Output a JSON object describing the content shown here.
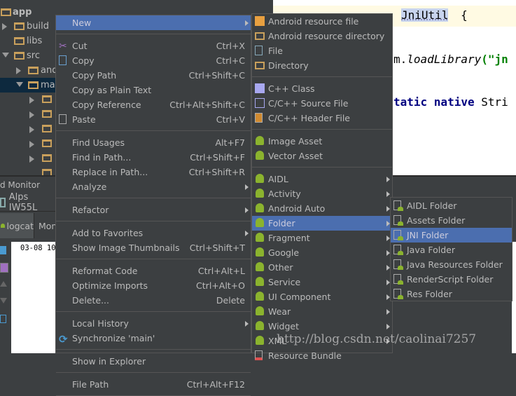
{
  "project_tree": {
    "items": [
      {
        "label": "app",
        "depth": 0,
        "expanded": true,
        "bold": true
      },
      {
        "label": "build",
        "depth": 0,
        "expanded": false
      },
      {
        "label": "libs",
        "depth": 0,
        "leaf": true
      },
      {
        "label": "src",
        "depth": 0,
        "expanded": true
      },
      {
        "label": "and",
        "depth": 1,
        "expanded": false
      },
      {
        "label": "mai",
        "depth": 1,
        "expanded": true,
        "selected": true
      }
    ]
  },
  "editor": {
    "line1": "JniUtil",
    "line1_brace": "{",
    "line2": "m.",
    "line2_method": "loadLibrary",
    "line2_arg": "(\"jn",
    "line3_kw": "tatic native",
    "line3_rest": "Stri"
  },
  "bottom_panel": {
    "title": "d Monitor",
    "device": "Alps IW55L",
    "tabs": [
      "logcat",
      "Mon"
    ],
    "log_line": "03-08 10"
  },
  "main_menu": [
    {
      "label": "New",
      "arrow": true,
      "selected": true
    },
    {
      "sep": true
    },
    {
      "label": "Cut",
      "shortcut": "Ctrl+X",
      "icon": "scissors-icon"
    },
    {
      "label": "Copy",
      "shortcut": "Ctrl+C",
      "icon": "copy-icon"
    },
    {
      "label": "Copy Path",
      "shortcut": "Ctrl+Shift+C"
    },
    {
      "label": "Copy as Plain Text"
    },
    {
      "label": "Copy Reference",
      "shortcut": "Ctrl+Alt+Shift+C"
    },
    {
      "label": "Paste",
      "shortcut": "Ctrl+V",
      "icon": "paste-icon"
    },
    {
      "sep": true
    },
    {
      "label": "Find Usages",
      "shortcut": "Alt+F7"
    },
    {
      "label": "Find in Path...",
      "shortcut": "Ctrl+Shift+F"
    },
    {
      "label": "Replace in Path...",
      "shortcut": "Ctrl+Shift+R"
    },
    {
      "label": "Analyze",
      "arrow": true
    },
    {
      "sep": true
    },
    {
      "label": "Refactor",
      "arrow": true
    },
    {
      "sep": true
    },
    {
      "label": "Add to Favorites",
      "arrow": true
    },
    {
      "label": "Show Image Thumbnails",
      "shortcut": "Ctrl+Shift+T"
    },
    {
      "sep": true
    },
    {
      "label": "Reformat Code",
      "shortcut": "Ctrl+Alt+L"
    },
    {
      "label": "Optimize Imports",
      "shortcut": "Ctrl+Alt+O"
    },
    {
      "label": "Delete...",
      "shortcut": "Delete"
    },
    {
      "sep": true
    },
    {
      "label": "Local History",
      "arrow": true
    },
    {
      "label": "Synchronize 'main'",
      "icon": "sync-icon"
    },
    {
      "sep": true
    },
    {
      "label": "Show in Explorer"
    },
    {
      "sep": true
    },
    {
      "label": "File Path",
      "shortcut": "Ctrl+Alt+F12"
    },
    {
      "sep": true
    }
  ],
  "new_submenu": [
    {
      "label": "Android resource file",
      "icon": "android-resource-file-icon"
    },
    {
      "label": "Android resource directory",
      "icon": "folder-icon"
    },
    {
      "label": "File",
      "icon": "file-icon"
    },
    {
      "label": "Directory",
      "icon": "folder-icon"
    },
    {
      "sep": true
    },
    {
      "label": "C++ Class",
      "icon": "cpp-class-icon"
    },
    {
      "label": "C/C++ Source File",
      "icon": "cpp-source-icon"
    },
    {
      "label": "C/C++ Header File",
      "icon": "cpp-header-icon"
    },
    {
      "sep": true
    },
    {
      "label": "Image Asset",
      "icon": "android-icon"
    },
    {
      "label": "Vector Asset",
      "icon": "android-icon"
    },
    {
      "sep": true
    },
    {
      "label": "AIDL",
      "icon": "android-icon",
      "arrow": true
    },
    {
      "label": "Activity",
      "icon": "android-icon",
      "arrow": true
    },
    {
      "label": "Android Auto",
      "icon": "android-icon",
      "arrow": true
    },
    {
      "label": "Folder",
      "icon": "android-icon",
      "arrow": true,
      "selected": true
    },
    {
      "label": "Fragment",
      "icon": "android-icon",
      "arrow": true
    },
    {
      "label": "Google",
      "icon": "android-icon",
      "arrow": true
    },
    {
      "label": "Other",
      "icon": "android-icon",
      "arrow": true
    },
    {
      "label": "Service",
      "icon": "android-icon",
      "arrow": true
    },
    {
      "label": "UI Component",
      "icon": "android-icon",
      "arrow": true
    },
    {
      "label": "Wear",
      "icon": "android-icon",
      "arrow": true
    },
    {
      "label": "Widget",
      "icon": "android-icon",
      "arrow": true
    },
    {
      "label": "XML",
      "icon": "android-icon",
      "arrow": true
    },
    {
      "label": "Resource Bundle",
      "icon": "resource-bundle-icon"
    }
  ],
  "folder_submenu": [
    {
      "label": "AIDL Folder"
    },
    {
      "label": "Assets Folder"
    },
    {
      "label": "JNI Folder",
      "selected": true
    },
    {
      "label": "Java Folder"
    },
    {
      "label": "Java Resources Folder"
    },
    {
      "label": "RenderScript Folder"
    },
    {
      "label": "Res Folder"
    }
  ],
  "watermark": "http://blog.csdn.net/caolinai7257",
  "colors": {
    "menu_bg": "#3c3f41",
    "selection": "#4b6eaf",
    "android_green": "#8bb32e"
  }
}
